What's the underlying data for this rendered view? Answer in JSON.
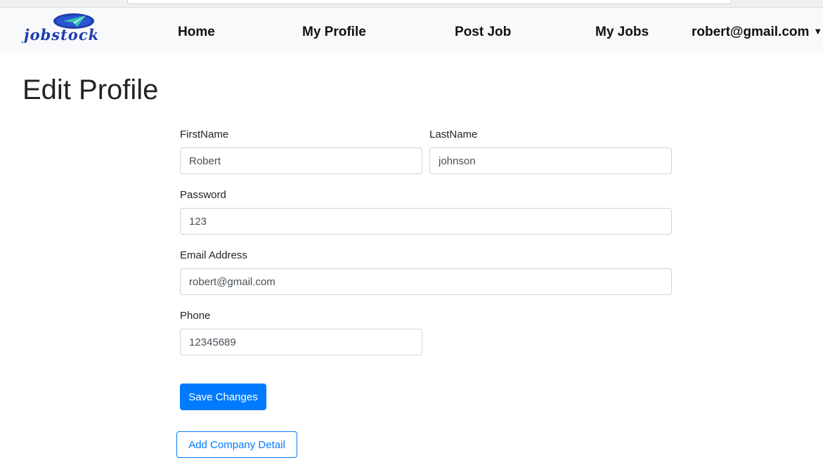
{
  "nav": {
    "logo_text": "jobstock",
    "home": "Home",
    "my_profile": "My Profile",
    "post_job": "Post Job",
    "my_jobs": "My Jobs",
    "user_email": "robert@gmail.com"
  },
  "page": {
    "title": "Edit Profile"
  },
  "form": {
    "first_name_label": "FirstName",
    "first_name_value": "Robert",
    "last_name_label": "LastName",
    "last_name_value": "johnson",
    "password_label": "Password",
    "password_value": "123",
    "email_label": "Email Address",
    "email_value": "robert@gmail.com",
    "phone_label": "Phone",
    "phone_value": "12345689",
    "save_label": "Save Changes",
    "add_company_label": "Add Company Detail"
  },
  "colors": {
    "primary": "#007bff",
    "navbar_bg": "#f8f9fa",
    "logo_blue": "#1f3fae",
    "logo_teal": "#35c3b5"
  },
  "icons": {
    "logo": "paper-plane-logo",
    "user_menu": "chevron-down-icon"
  }
}
